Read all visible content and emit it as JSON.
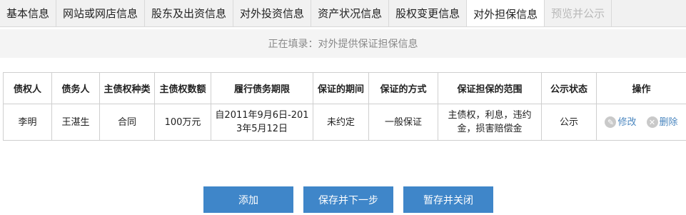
{
  "tabs": [
    {
      "label": "基本信息",
      "state": "normal"
    },
    {
      "label": "网站或网店信息",
      "state": "normal"
    },
    {
      "label": "股东及出资信息",
      "state": "normal"
    },
    {
      "label": "对外投资信息",
      "state": "normal"
    },
    {
      "label": "资产状况信息",
      "state": "normal"
    },
    {
      "label": "股权变更信息",
      "state": "normal"
    },
    {
      "label": "对外担保信息",
      "state": "active"
    },
    {
      "label": "预览并公示",
      "state": "disabled"
    }
  ],
  "status_line": "正在填录：对外提供保证担保信息",
  "table": {
    "headers": [
      "债权人",
      "债务人",
      "主债权种类",
      "主债权数额",
      "履行债务期限",
      "保证的期间",
      "保证的方式",
      "保证担保的范围",
      "公示状态",
      "操作"
    ],
    "rows": [
      {
        "creditor": "李明",
        "debtor": "王湛生",
        "claim_type": "合同",
        "claim_amount": "100万元",
        "term_line1": "自2011年9月6日-201",
        "term_line2": "3年5月12日",
        "guarantee_period": "未约定",
        "guarantee_method": "一般保证",
        "scope_line1": "主债权，利息，违约",
        "scope_line2": "金，损害赔偿金",
        "status": "公示",
        "edit_label": "修改",
        "delete_label": "删除"
      }
    ]
  },
  "buttons": {
    "add": "添加",
    "save_next": "保存并下一步",
    "save_close": "暂存并关闭"
  },
  "colors": {
    "active_tab_underline": "#a82020",
    "button_bg": "#3f86c9",
    "link": "#4a86bf"
  }
}
